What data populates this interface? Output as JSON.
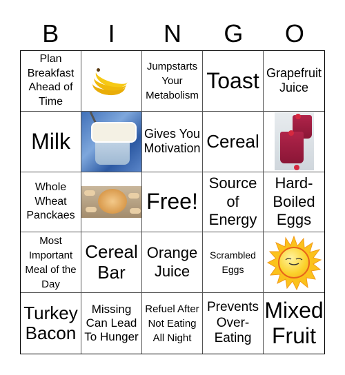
{
  "header": {
    "letters": [
      "B",
      "I",
      "N",
      "G",
      "O"
    ]
  },
  "cells": [
    {
      "text": "Plan Breakfast Ahead of Time"
    },
    {
      "image": "bananas"
    },
    {
      "text": "Jumpstarts Your Metabolism"
    },
    {
      "text": "Toast"
    },
    {
      "text": "Grapefruit Juice"
    },
    {
      "text": "Milk"
    },
    {
      "image": "yogurt-cup"
    },
    {
      "text": "Gives You Motivation"
    },
    {
      "text": "Cereal"
    },
    {
      "image": "berry-smoothie"
    },
    {
      "text": "Whole Wheat Panckaes"
    },
    {
      "image": "peanut-butter"
    },
    {
      "text": "Free!"
    },
    {
      "text": "Source of Energy"
    },
    {
      "text": "Hard-Boiled Eggs"
    },
    {
      "text": "Most Important Meal of the Day"
    },
    {
      "text": "Cereal Bar"
    },
    {
      "text": "Orange Juice"
    },
    {
      "text": "Scrambled Eggs"
    },
    {
      "image": "smiling-sun"
    },
    {
      "text": "Turkey Bacon"
    },
    {
      "text": "Missing Can Lead To Hunger"
    },
    {
      "text": "Refuel After Not Eating All Night"
    },
    {
      "text": "Prevents Over-Eating"
    },
    {
      "text": "Mixed Fruit"
    }
  ]
}
